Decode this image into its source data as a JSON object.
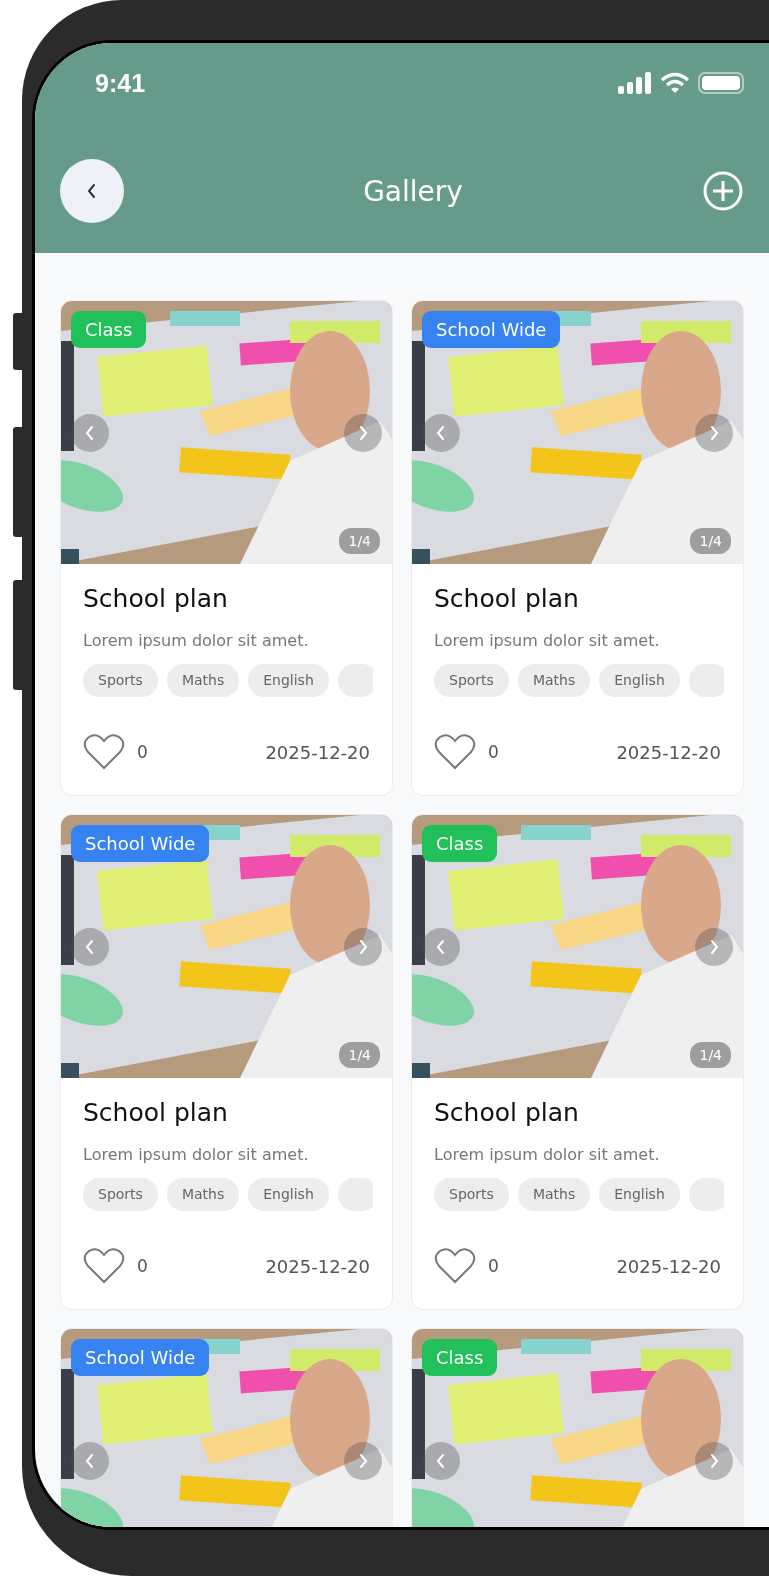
{
  "status_bar": {
    "time": "9:41"
  },
  "header": {
    "title": "Gallery"
  },
  "cards": [
    {
      "badge": {
        "label": "Class",
        "color": "#22c05a"
      },
      "counter": "1/4",
      "title": "School plan",
      "description": "Lorem ipsum dolor sit amet.",
      "tags": [
        "Sports",
        "Maths",
        "English"
      ],
      "likes": "0",
      "date": "2025-12-20"
    },
    {
      "badge": {
        "label": "School Wide",
        "color": "#3582f0"
      },
      "counter": "1/4",
      "title": "School plan",
      "description": "Lorem ipsum dolor sit amet.",
      "tags": [
        "Sports",
        "Maths",
        "English"
      ],
      "likes": "0",
      "date": "2025-12-20"
    },
    {
      "badge": {
        "label": "School Wide",
        "color": "#3582f0"
      },
      "counter": "1/4",
      "title": "School plan",
      "description": "Lorem ipsum dolor sit amet.",
      "tags": [
        "Sports",
        "Maths",
        "English"
      ],
      "likes": "0",
      "date": "2025-12-20"
    },
    {
      "badge": {
        "label": "Class",
        "color": "#22c05a"
      },
      "counter": "1/4",
      "title": "School plan",
      "description": "Lorem ipsum dolor sit amet.",
      "tags": [
        "Sports",
        "Maths",
        "English"
      ],
      "likes": "0",
      "date": "2025-12-20"
    },
    {
      "badge": {
        "label": "School Wide",
        "color": "#3582f0"
      }
    },
    {
      "badge": {
        "label": "Class",
        "color": "#22c05a"
      }
    }
  ]
}
